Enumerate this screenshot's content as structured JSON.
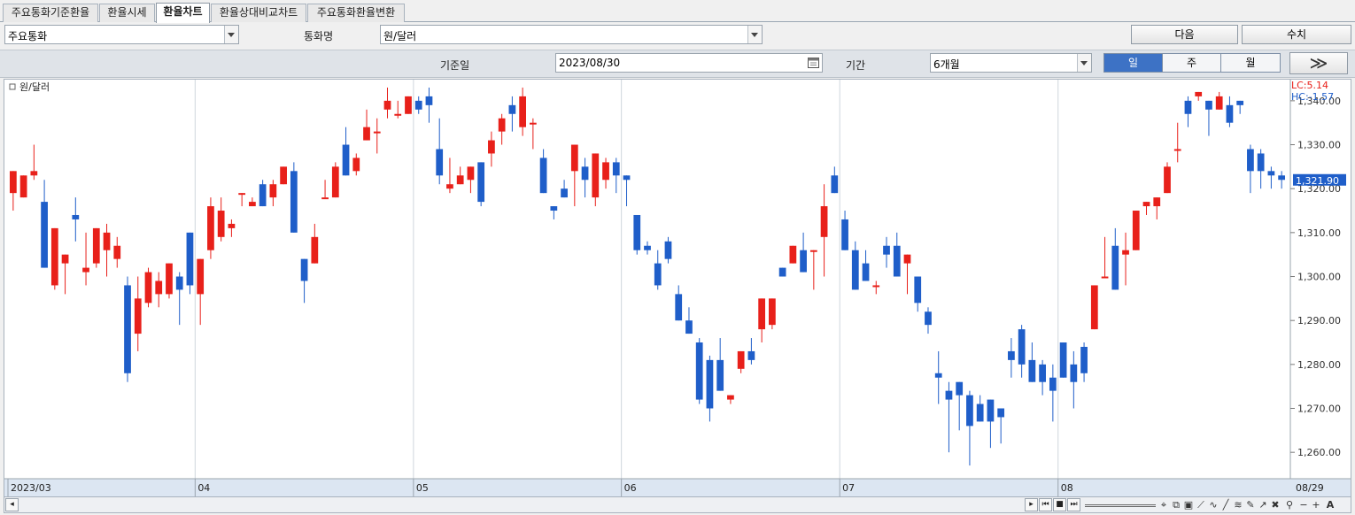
{
  "tabs": [
    {
      "label": "주요통화기준환율",
      "active": false
    },
    {
      "label": "환율시세",
      "active": false
    },
    {
      "label": "환율차트",
      "active": true
    },
    {
      "label": "환율상대비교차트",
      "active": false
    },
    {
      "label": "주요통화환율변환",
      "active": false
    }
  ],
  "row1": {
    "group_value": "주요통화",
    "currency_label": "통화명",
    "currency_value": "원/달러",
    "next_label": "다음",
    "numeric_label": "수치"
  },
  "row2": {
    "date_label": "기준일",
    "date_value": "2023/08/30",
    "period_label": "기간",
    "period_value": "6개월",
    "periods": [
      {
        "label": "일",
        "active": true
      },
      {
        "label": "주",
        "active": false
      },
      {
        "label": "월",
        "active": false
      }
    ],
    "forward_glyph": "≫"
  },
  "chart": {
    "legend": "원/달러",
    "lc_label": "LC:5.14",
    "hc_label": "HC:-1.57",
    "last_price_label": "1,321.90",
    "colors": {
      "up": "#e8201a",
      "down": "#1f5ec9",
      "panel": "#dce6f2"
    },
    "bottom_right_label": "08/29"
  },
  "chart_data": {
    "type": "candlestick",
    "title": "원/달러",
    "ylim": [
      1255,
      1344
    ],
    "y_ticks": [
      1260,
      1270,
      1280,
      1290,
      1300,
      1310,
      1320,
      1330,
      1340
    ],
    "y_tick_labels": [
      "1,260.00",
      "1,270.00",
      "1,280.00",
      "1,290.00",
      "1,300.00",
      "1,310.00",
      "1,320.00",
      "1,330.00",
      "1,340.00"
    ],
    "x_labels": [
      "2023/03",
      "04",
      "05",
      "06",
      "07",
      "08"
    ],
    "last_close": 1321.9,
    "candles": [
      [
        1319,
        1324,
        1315,
        1324
      ],
      [
        1318,
        1323,
        1318,
        1323
      ],
      [
        1323,
        1330,
        1322,
        1324
      ],
      [
        1317,
        1322,
        1302,
        1302
      ],
      [
        1298,
        1311,
        1297,
        1311
      ],
      [
        1303,
        1305,
        1296,
        1305
      ],
      [
        1314,
        1318,
        1308,
        1313
      ],
      [
        1301,
        1310,
        1298,
        1302
      ],
      [
        1303,
        1311,
        1302,
        1311
      ],
      [
        1306,
        1312,
        1300,
        1310
      ],
      [
        1304,
        1309,
        1302,
        1307
      ],
      [
        1298,
        1300,
        1276,
        1278
      ],
      [
        1287,
        1300,
        1283,
        1295
      ],
      [
        1294,
        1302,
        1293,
        1301
      ],
      [
        1296,
        1301,
        1293,
        1299
      ],
      [
        1296,
        1303,
        1295,
        1303
      ],
      [
        1300,
        1301,
        1289,
        1297
      ],
      [
        1310,
        1310,
        1296,
        1298
      ],
      [
        1296,
        1304,
        1289,
        1304
      ],
      [
        1306,
        1318,
        1304,
        1316
      ],
      [
        1309,
        1318,
        1308,
        1315
      ],
      [
        1311,
        1313,
        1309,
        1312
      ],
      [
        1319,
        1319,
        1316,
        1319
      ],
      [
        1316,
        1318,
        1316,
        1317
      ],
      [
        1321,
        1322,
        1316,
        1316
      ],
      [
        1318,
        1322,
        1316,
        1321
      ],
      [
        1321,
        1325,
        1321,
        1325
      ],
      [
        1324,
        1326,
        1310,
        1310
      ],
      [
        1304,
        1304,
        1294,
        1299
      ],
      [
        1303,
        1312,
        1303,
        1309
      ],
      [
        1318,
        1322,
        1318,
        1318
      ],
      [
        1318,
        1326,
        1318,
        1325
      ],
      [
        1330,
        1334,
        1324,
        1323
      ],
      [
        1324,
        1328,
        1323,
        1327
      ],
      [
        1331,
        1338,
        1331,
        1334
      ],
      [
        1333,
        1336,
        1328,
        1333
      ],
      [
        1338,
        1343,
        1336,
        1340
      ],
      [
        1337,
        1340,
        1336,
        1337
      ],
      [
        1337,
        1341,
        1337,
        1341
      ],
      [
        1340,
        1341,
        1337,
        1338
      ],
      [
        1341,
        1343,
        1335,
        1339
      ],
      [
        1329,
        1336,
        1321,
        1323
      ],
      [
        1320,
        1327,
        1319,
        1321
      ],
      [
        1321,
        1325,
        1321,
        1323
      ],
      [
        1322,
        1325,
        1319,
        1325
      ],
      [
        1326,
        1326,
        1316,
        1317
      ],
      [
        1328,
        1333,
        1325,
        1331
      ],
      [
        1333,
        1337,
        1330,
        1336
      ],
      [
        1339,
        1341,
        1333,
        1337
      ],
      [
        1334,
        1343,
        1332,
        1341
      ],
      [
        1335,
        1336,
        1329,
        1335
      ],
      [
        1327,
        1329,
        1319,
        1319
      ],
      [
        1316,
        1315,
        1313,
        1315
      ],
      [
        1320,
        1322,
        1318,
        1318
      ],
      [
        1324,
        1325,
        1316,
        1330
      ],
      [
        1325,
        1327,
        1318,
        1322
      ],
      [
        1318,
        1326,
        1316,
        1328
      ],
      [
        1322,
        1327,
        1320,
        1326
      ],
      [
        1326,
        1327,
        1319,
        1323
      ],
      [
        1323,
        1323,
        1316,
        1322
      ],
      [
        1314,
        1314,
        1305,
        1306
      ],
      [
        1307,
        1308,
        1305,
        1306
      ],
      [
        1303,
        1306,
        1297,
        1298
      ],
      [
        1308,
        1309,
        1303,
        1304
      ],
      [
        1296,
        1298,
        1292,
        1290
      ],
      [
        1290,
        1293,
        1288,
        1287
      ],
      [
        1285,
        1286,
        1271,
        1272
      ],
      [
        1281,
        1282,
        1267,
        1270
      ],
      [
        1281,
        1286,
        1274,
        1274
      ],
      [
        1272,
        1273,
        1271,
        1273
      ],
      [
        1279,
        1283,
        1278,
        1283
      ],
      [
        1283,
        1286,
        1280,
        1281
      ],
      [
        1288,
        1289,
        1285,
        1295
      ],
      [
        1289,
        1290,
        1288,
        1295
      ],
      [
        1302,
        1302,
        1300,
        1300
      ],
      [
        1303,
        1306,
        1303,
        1307
      ],
      [
        1306,
        1310,
        1302,
        1301
      ],
      [
        1306,
        1306,
        1297,
        1306
      ],
      [
        1309,
        1321,
        1300,
        1316
      ],
      [
        1323,
        1325,
        1319,
        1319
      ],
      [
        1313,
        1315,
        1306,
        1306
      ],
      [
        1306,
        1308,
        1298,
        1297
      ],
      [
        1303,
        1306,
        1299,
        1299
      ],
      [
        1298,
        1299,
        1296,
        1298
      ],
      [
        1307,
        1309,
        1302,
        1305
      ],
      [
        1307,
        1310,
        1300,
        1300
      ],
      [
        1303,
        1304,
        1296,
        1305
      ],
      [
        1300,
        1300,
        1292,
        1294
      ],
      [
        1292,
        1293,
        1287,
        1289
      ],
      [
        1278,
        1283,
        1271,
        1277
      ],
      [
        1274,
        1276,
        1260,
        1272
      ],
      [
        1276,
        1272,
        1265,
        1273
      ],
      [
        1273,
        1274,
        1257,
        1266
      ],
      [
        1271,
        1273,
        1268,
        1267
      ],
      [
        1272,
        1272,
        1261,
        1267
      ],
      [
        1270,
        1270,
        1262,
        1268
      ],
      [
        1283,
        1286,
        1277,
        1281
      ],
      [
        1288,
        1289,
        1277,
        1280
      ],
      [
        1281,
        1285,
        1276,
        1276
      ],
      [
        1280,
        1281,
        1273,
        1276
      ],
      [
        1277,
        1280,
        1267,
        1274
      ],
      [
        1285,
        1285,
        1279,
        1277
      ],
      [
        1280,
        1283,
        1270,
        1276
      ],
      [
        1284,
        1285,
        1276,
        1278
      ],
      [
        1288,
        1298,
        1288,
        1298
      ],
      [
        1300,
        1309,
        1300,
        1300
      ],
      [
        1307,
        1311,
        1297,
        1297
      ],
      [
        1305,
        1310,
        1298,
        1306
      ],
      [
        1306,
        1312,
        1306,
        1315
      ],
      [
        1316,
        1317,
        1314,
        1317
      ],
      [
        1316,
        1317,
        1313,
        1318
      ],
      [
        1319,
        1326,
        1319,
        1325
      ],
      [
        1329,
        1335,
        1326,
        1329
      ],
      [
        1340,
        1341,
        1334,
        1337
      ],
      [
        1341,
        1342,
        1340,
        1342
      ],
      [
        1340,
        1340,
        1332,
        1338
      ],
      [
        1338,
        1342,
        1338,
        1341
      ],
      [
        1339,
        1341,
        1334,
        1335
      ],
      [
        1340,
        1340,
        1337,
        1339
      ],
      [
        1329,
        1330,
        1319,
        1324
      ],
      [
        1328,
        1329,
        1320,
        1324
      ],
      [
        1324,
        1325,
        1320,
        1323
      ],
      [
        1323,
        1324,
        1320,
        1322
      ]
    ]
  }
}
